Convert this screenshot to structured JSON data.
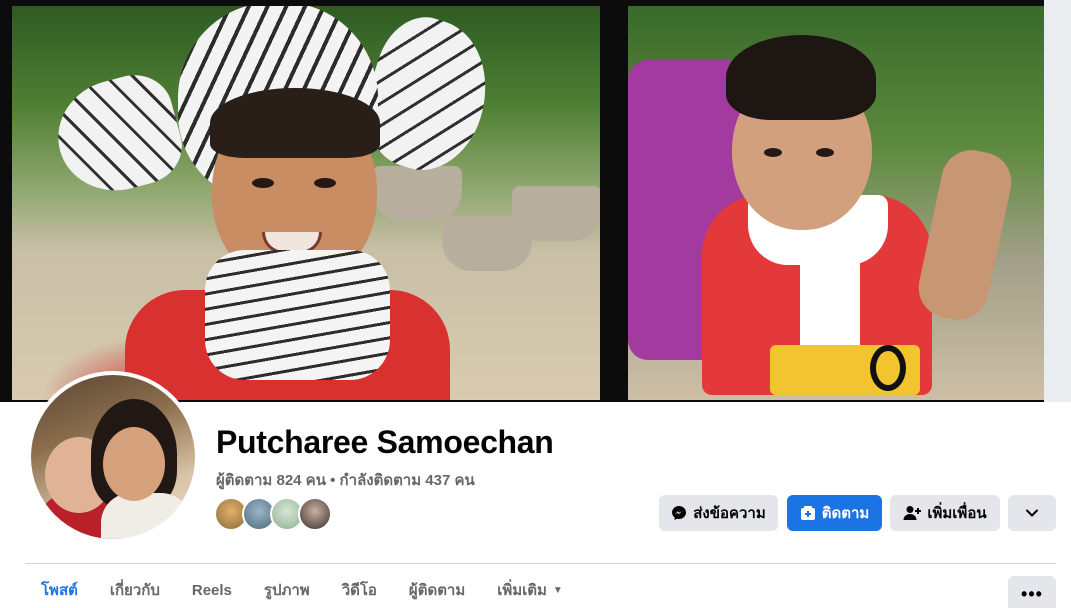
{
  "profile": {
    "name": "Putcharee Samoechan",
    "stats": "ผู้ติดตาม 824 คน • กำลังติดตาม 437 คน"
  },
  "actions": {
    "message_label": "ส่งข้อความ",
    "follow_label": "ติดตาม",
    "add_friend_label": "เพิ่มเพื่อน"
  },
  "tabs": [
    {
      "label": "โพสต์",
      "active": true
    },
    {
      "label": "เกี่ยวกับ"
    },
    {
      "label": "Reels"
    },
    {
      "label": "รูปภาพ"
    },
    {
      "label": "วิดีโอ"
    },
    {
      "label": "ผู้ติดตาม"
    },
    {
      "label": "เพิ่มเติม"
    }
  ],
  "colors": {
    "accent": "#1b74e4",
    "button_gray": "#e4e6eb",
    "secondary_text": "#65676b"
  },
  "icons": {
    "message": "messenger-icon",
    "follow": "follow-icon",
    "add_friend": "add-friend-icon",
    "dropdown": "chevron-down-icon",
    "more": "more-dots-icon"
  }
}
